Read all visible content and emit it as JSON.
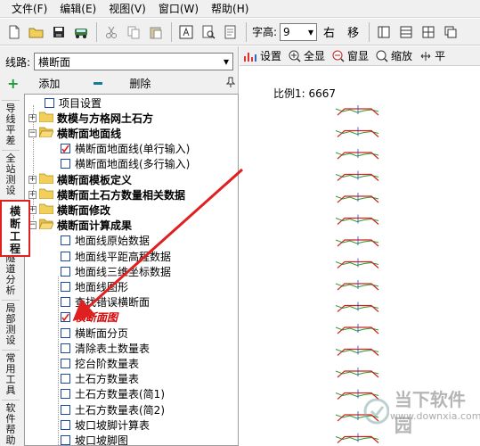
{
  "menubar": {
    "items": [
      "文件(F)",
      "编辑(E)",
      "视图(V)",
      "窗口(W)",
      "帮助(H)"
    ]
  },
  "toolbar": {
    "font_label": "字高:",
    "font_value": "9",
    "right_label": "右",
    "move_label": "移"
  },
  "left": {
    "route_label": "线路:",
    "route_value": "横断面",
    "add_label": "添加",
    "delete_label": "删除",
    "pin": "ꟼ"
  },
  "vtabs": [
    {
      "label": "导线平差"
    },
    {
      "label": "全站测设"
    },
    {
      "label": "横断工程"
    },
    {
      "label": "隧道分析"
    },
    {
      "label": "局部测设"
    },
    {
      "label": "常用工具"
    },
    {
      "label": "软件帮助"
    }
  ],
  "tree": {
    "items": [
      {
        "label": "项目设置",
        "type": "check"
      },
      {
        "label": "数模与方格网土石方",
        "type": "folder-collapsed"
      },
      {
        "label": "横断面地面线",
        "type": "folder-open"
      },
      {
        "label": "横断面地面线(单行输入)",
        "type": "checked"
      },
      {
        "label": "横断面地面线(多行输入)",
        "type": "check"
      },
      {
        "label": "横断面模板定义",
        "type": "folder-collapsed"
      },
      {
        "label": "横断面土石方数量相关数据",
        "type": "folder-collapsed"
      },
      {
        "label": "横断面修改",
        "type": "folder-collapsed"
      },
      {
        "label": "横断面计算成果",
        "type": "folder-open"
      },
      {
        "label": "地面线原始数据",
        "type": "check"
      },
      {
        "label": "地面线平距高程数据",
        "type": "check"
      },
      {
        "label": "地面线三维坐标数据",
        "type": "check"
      },
      {
        "label": "地面线图形",
        "type": "check"
      },
      {
        "label": "查找错误横断面",
        "type": "check"
      },
      {
        "label": "横断面图",
        "type": "checked-red"
      },
      {
        "label": "横断面分页",
        "type": "check"
      },
      {
        "label": "清除表土数量表",
        "type": "check"
      },
      {
        "label": "挖台阶数量表",
        "type": "check"
      },
      {
        "label": "土石方数量表",
        "type": "check"
      },
      {
        "label": "土石方数量表(简1)",
        "type": "check"
      },
      {
        "label": "土石方数量表(简2)",
        "type": "check"
      },
      {
        "label": "坡口坡脚计算表",
        "type": "check"
      },
      {
        "label": "坡口坡脚图",
        "type": "check"
      }
    ]
  },
  "right_toolbar": {
    "items": [
      "设置",
      "全显",
      "窗显",
      "缩放",
      "平"
    ]
  },
  "drawing": {
    "scale_label": "比例1: 6667",
    "section_count": 17
  },
  "watermark": {
    "text": "当下软件园",
    "url": "www.downxia.com"
  },
  "colors": {
    "accent_red": "#e02020",
    "tree_border": "#1c4aa0",
    "folder": "#f2cf5b"
  }
}
